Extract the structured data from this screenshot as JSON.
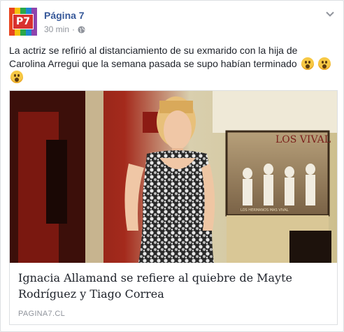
{
  "page": {
    "name": "Página 7",
    "avatar_text": "P7",
    "timestamp": "30 min",
    "separator": "·",
    "privacy_icon": "globe-icon",
    "menu_icon": "chevron-down-icon"
  },
  "post": {
    "text": "La actriz se refirió al distanciamiento de su exmarido con la hija de Carolina Arregui que la semana pasada se supo habían terminado",
    "emoji": "astonished-face-emoji"
  },
  "link": {
    "title": "Ignacia Allamand se refiere al quiebre de Mayte Rodríguez y Tiago Correa",
    "domain": "PAGINA7.CL",
    "poster_text": "LOS VIVAL",
    "poster_subtext": "LOS HERMANOS MAS VIVAL"
  },
  "colors": {
    "link_blue": "#365899",
    "meta_gray": "#90949c",
    "avatar_yellow": "#f4c20d",
    "avatar_red": "#d8312f"
  }
}
